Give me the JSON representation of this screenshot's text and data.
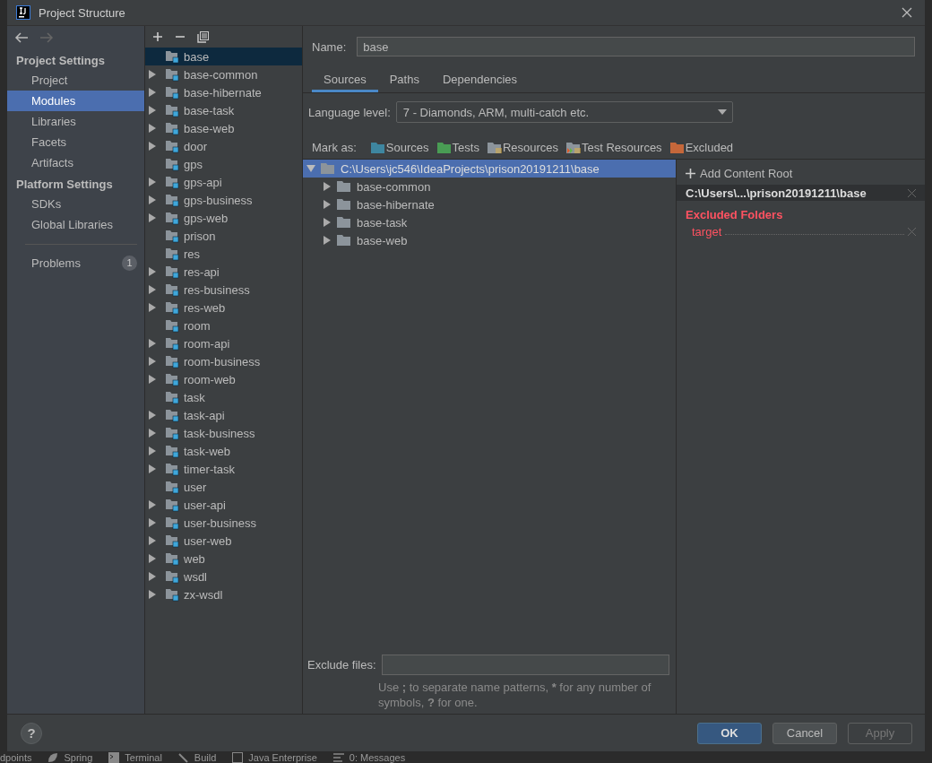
{
  "window": {
    "title": "Project Structure"
  },
  "nav": {
    "sections": [
      {
        "title": "Project Settings",
        "items": [
          {
            "label": "Project",
            "selected": false
          },
          {
            "label": "Modules",
            "selected": true
          },
          {
            "label": "Libraries",
            "selected": false
          },
          {
            "label": "Facets",
            "selected": false
          },
          {
            "label": "Artifacts",
            "selected": false
          }
        ]
      },
      {
        "title": "Platform Settings",
        "items": [
          {
            "label": "SDKs",
            "selected": false
          },
          {
            "label": "Global Libraries",
            "selected": false
          }
        ]
      }
    ],
    "problems": {
      "label": "Problems",
      "count": "1"
    }
  },
  "modules": [
    {
      "label": "base",
      "kind": "leaf",
      "selected": true
    },
    {
      "label": "base-common",
      "kind": "group",
      "selected": false
    },
    {
      "label": "base-hibernate",
      "kind": "group",
      "selected": false
    },
    {
      "label": "base-task",
      "kind": "group",
      "selected": false
    },
    {
      "label": "base-web",
      "kind": "group",
      "selected": false
    },
    {
      "label": "door",
      "kind": "group",
      "selected": false
    },
    {
      "label": "gps",
      "kind": "leaf",
      "selected": false
    },
    {
      "label": "gps-api",
      "kind": "group",
      "selected": false
    },
    {
      "label": "gps-business",
      "kind": "group",
      "selected": false
    },
    {
      "label": "gps-web",
      "kind": "group",
      "selected": false
    },
    {
      "label": "prison",
      "kind": "leaf",
      "selected": false
    },
    {
      "label": "res",
      "kind": "leaf",
      "selected": false
    },
    {
      "label": "res-api",
      "kind": "group",
      "selected": false
    },
    {
      "label": "res-business",
      "kind": "group",
      "selected": false
    },
    {
      "label": "res-web",
      "kind": "group",
      "selected": false
    },
    {
      "label": "room",
      "kind": "leaf",
      "selected": false
    },
    {
      "label": "room-api",
      "kind": "group",
      "selected": false
    },
    {
      "label": "room-business",
      "kind": "group",
      "selected": false
    },
    {
      "label": "room-web",
      "kind": "group",
      "selected": false
    },
    {
      "label": "task",
      "kind": "leaf",
      "selected": false
    },
    {
      "label": "task-api",
      "kind": "group",
      "selected": false
    },
    {
      "label": "task-business",
      "kind": "group",
      "selected": false
    },
    {
      "label": "task-web",
      "kind": "group",
      "selected": false
    },
    {
      "label": "timer-task",
      "kind": "group",
      "selected": false
    },
    {
      "label": "user",
      "kind": "leaf",
      "selected": false
    },
    {
      "label": "user-api",
      "kind": "group",
      "selected": false
    },
    {
      "label": "user-business",
      "kind": "group",
      "selected": false
    },
    {
      "label": "user-web",
      "kind": "group",
      "selected": false
    },
    {
      "label": "web",
      "kind": "group",
      "selected": false
    },
    {
      "label": "wsdl",
      "kind": "group",
      "selected": false
    },
    {
      "label": "zx-wsdl",
      "kind": "group",
      "selected": false
    }
  ],
  "name_field": {
    "label": "Name:",
    "value": "base"
  },
  "tabs": [
    {
      "label": "Sources",
      "selected": true
    },
    {
      "label": "Paths",
      "selected": false
    },
    {
      "label": "Dependencies",
      "selected": false
    }
  ],
  "language_level": {
    "label": "Language level:",
    "value": "7 - Diamonds, ARM, multi-catch etc."
  },
  "mark_as": {
    "label": "Mark as:",
    "items": [
      {
        "label": "Sources",
        "kind": "sources"
      },
      {
        "label": "Tests",
        "kind": "tests"
      },
      {
        "label": "Resources",
        "kind": "resources"
      },
      {
        "label": "Test Resources",
        "kind": "test-resources"
      },
      {
        "label": "Excluded",
        "kind": "excluded"
      }
    ]
  },
  "content_tree": {
    "label": "C:\\Users\\jc546\\IdeaProjects\\prison20191211\\base",
    "expanded": true,
    "selected": true,
    "children": [
      {
        "label": "base-common",
        "expanded": false,
        "selected": false
      },
      {
        "label": "base-hibernate",
        "expanded": false,
        "selected": false
      },
      {
        "label": "base-task",
        "expanded": false,
        "selected": false
      },
      {
        "label": "base-web",
        "expanded": false,
        "selected": false
      }
    ]
  },
  "content_root_panel": {
    "add_label": "Add Content Root",
    "root_path": "C:\\Users\\...\\prison20191211\\base",
    "excluded_title": "Excluded Folders",
    "excluded": [
      "target"
    ]
  },
  "exclude_files": {
    "label": "Exclude files:",
    "hint": [
      {
        "text": "Use ",
        "bold": false
      },
      {
        "text": ";",
        "bold": true
      },
      {
        "text": " to separate name patterns, ",
        "bold": false
      },
      {
        "text": "*",
        "bold": true
      },
      {
        "text": " for any number of symbols, ",
        "bold": false
      },
      {
        "text": "?",
        "bold": true
      },
      {
        "text": " for one.",
        "bold": false
      }
    ]
  },
  "help": {
    "label": "?"
  },
  "buttons": [
    {
      "label": "OK",
      "kind": "primary"
    },
    {
      "label": "Cancel",
      "kind": "normal"
    },
    {
      "label": "Apply",
      "kind": "disabled"
    }
  ],
  "ide_toolbar": [
    {
      "label": "dpoints",
      "kind": "text"
    },
    {
      "label": "Spring",
      "kind": "spring"
    },
    {
      "label": "Terminal",
      "kind": "terminal"
    },
    {
      "label": "Build",
      "kind": "build"
    },
    {
      "label": "Java Enterprise",
      "kind": "enterprise"
    },
    {
      "label": "0: Messages",
      "kind": "messages"
    }
  ]
}
